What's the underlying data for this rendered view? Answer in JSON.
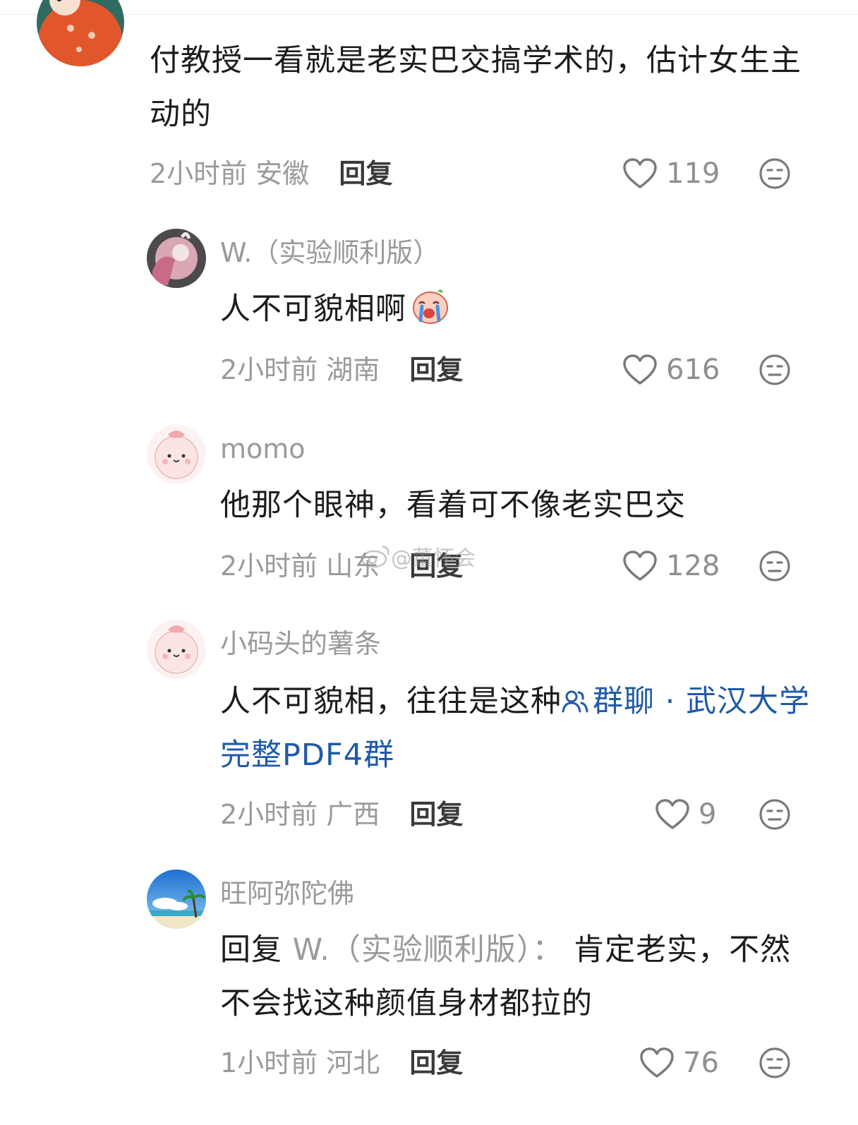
{
  "comments": [
    {
      "name": "",
      "text": "付教授一看就是老实巴交搞学术的，估计女生主动的",
      "time": "2小时前",
      "location": "安徽",
      "reply_label": "回复",
      "likes": "119"
    },
    {
      "name": "W.（实验顺利版）",
      "text": "人不可貌相啊",
      "time": "2小时前",
      "location": "湖南",
      "reply_label": "回复",
      "likes": "616"
    },
    {
      "name": "momo",
      "text": "他那个眼神，看着可不像老实巴交",
      "time": "2小时前",
      "location": "山东",
      "reply_label": "回复",
      "likes": "128"
    },
    {
      "name": "小码头的薯条",
      "text": "人不可貌相，往往是这种",
      "link_text": "群聊 · 武汉大学完整PDF4群",
      "time": "2小时前",
      "location": "广西",
      "reply_label": "回复",
      "likes": "9"
    },
    {
      "name": "旺阿弥陀佛",
      "reply_prefix": "回复",
      "reply_target": "W.（实验顺利版）：",
      "text": "肯定老实，不然不会找这种颜值身材都拉的",
      "time": "1小时前",
      "location": "河北",
      "reply_label": "回复",
      "likes": "76"
    }
  ],
  "watermark": "@董怀会",
  "colors": {
    "text": "#1c1c1c",
    "muted": "#9a9a9a",
    "link": "#1f5aa8",
    "reply": "#3a3a3a"
  },
  "icons": {
    "like": "heart-outline-icon",
    "dislike": "neutral-face-icon",
    "link": "group-chat-icon",
    "emoji": "crying-emoji-icon"
  }
}
